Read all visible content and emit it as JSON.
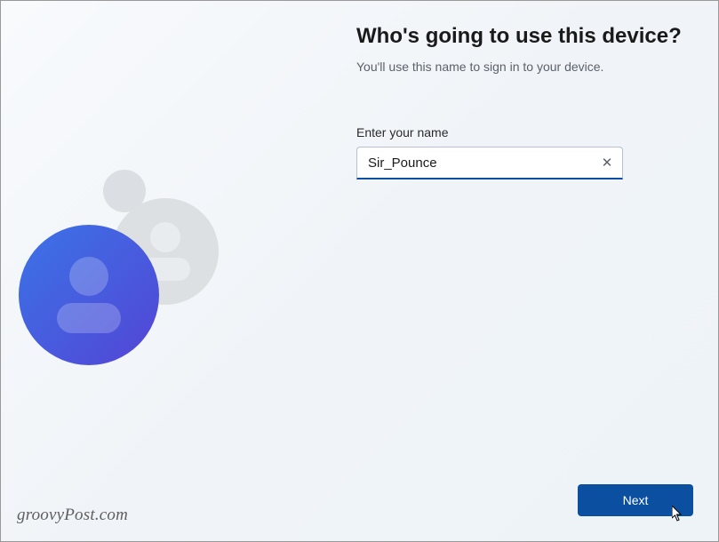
{
  "setup": {
    "heading": "Who's going to use this device?",
    "subheading": "You'll use this name to sign in to your device.",
    "field_label": "Enter your name",
    "name_value": "Sir_Pounce",
    "name_placeholder": ""
  },
  "actions": {
    "next_label": "Next"
  },
  "watermark": "groovyPost.com",
  "colors": {
    "accent": "#0a4fa0",
    "blue_gradient_start": "#3b74e8",
    "blue_gradient_end": "#5a45d4"
  },
  "icons": {
    "clear": "✕",
    "user": "person-icon"
  }
}
